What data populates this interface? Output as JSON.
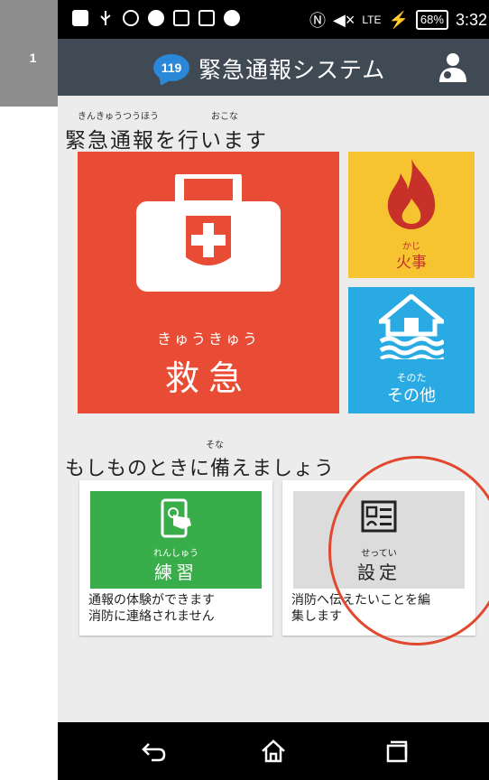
{
  "step_badge": "1",
  "status_bar": {
    "time": "3:32",
    "battery": "68%",
    "signal_label": "LTE"
  },
  "app_bar": {
    "logo_text": "119",
    "title": "緊急通報システム"
  },
  "section1": {
    "heading": "緊急通報を行います",
    "ruby_left": "きんきゅうつうほう",
    "ruby_right": "おこな"
  },
  "tiles": {
    "kyukyu": {
      "furigana": "きゅうきゅう",
      "label": "救急"
    },
    "kaji": {
      "furigana": "かじ",
      "label": "火事"
    },
    "sonota": {
      "furigana": "そのた",
      "label": "その他"
    }
  },
  "section2": {
    "heading": "もしものときに備えましょう",
    "ruby": "そな"
  },
  "cards": {
    "practice": {
      "furigana": "れんしゅう",
      "label": "練習",
      "desc_line1": "通報の体験ができます",
      "desc_line2": "消防に連絡されません"
    },
    "settings": {
      "furigana": "せってい",
      "label": "設定",
      "desc_line1": "消防へ伝えたいことを編",
      "desc_line2": "集します"
    }
  },
  "colors": {
    "appbar": "#404a55",
    "kyukyu": "#e84c35",
    "kaji": "#f5c430",
    "sonota": "#2aaae2",
    "practice": "#3aad4b",
    "highlight_circle": "#e2482e"
  },
  "icons": {
    "kyukyu": "first-aid-kit-icon",
    "kaji": "flame-icon",
    "sonota": "flooded-house-icon",
    "practice": "tablet-tap-icon",
    "settings": "profile-card-icon",
    "profile": "user-settings-icon",
    "nav": [
      "back-icon",
      "home-icon",
      "recents-icon"
    ]
  }
}
